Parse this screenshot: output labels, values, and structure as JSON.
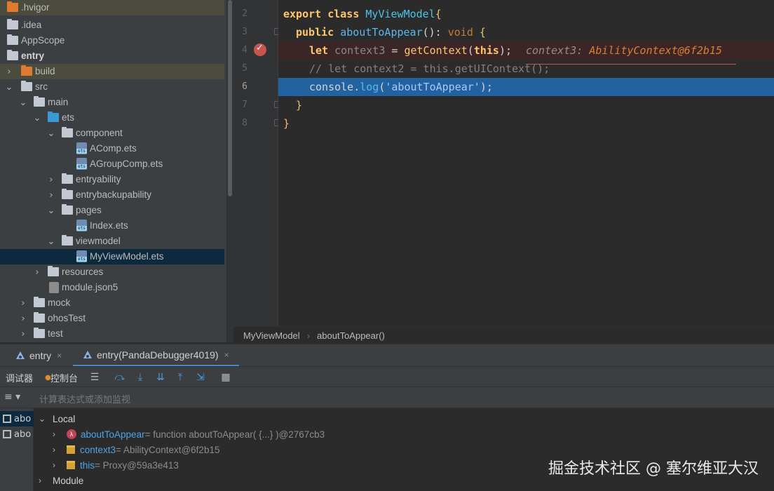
{
  "project_tree": {
    "items": [
      {
        "label": ".hvigor",
        "icon": "folder-orange-icon"
      },
      {
        "label": ".idea",
        "icon": "folder-icon"
      },
      {
        "label": "AppScope",
        "icon": "folder-icon"
      },
      {
        "label": "entry",
        "icon": "module-folder-icon"
      },
      {
        "label": "build",
        "icon": "folder-orange-icon"
      },
      {
        "label": "src",
        "icon": "folder-icon"
      },
      {
        "label": "main",
        "icon": "folder-icon"
      },
      {
        "label": "ets",
        "icon": "folder-blue-icon"
      },
      {
        "label": "component",
        "icon": "folder-icon"
      },
      {
        "label": "AComp.ets",
        "icon": "ets-file-icon"
      },
      {
        "label": "AGroupComp.ets",
        "icon": "ets-file-icon"
      },
      {
        "label": "entryability",
        "icon": "folder-icon"
      },
      {
        "label": "entrybackupability",
        "icon": "folder-icon"
      },
      {
        "label": "pages",
        "icon": "folder-icon"
      },
      {
        "label": "Index.ets",
        "icon": "ets-file-icon"
      },
      {
        "label": "viewmodel",
        "icon": "folder-icon"
      },
      {
        "label": "MyViewModel.ets",
        "icon": "ets-file-icon"
      },
      {
        "label": "resources",
        "icon": "folder-icon"
      },
      {
        "label": "module.json5",
        "icon": "json-file-icon"
      },
      {
        "label": "mock",
        "icon": "folder-icon"
      },
      {
        "label": "ohosTest",
        "icon": "folder-icon"
      },
      {
        "label": "test",
        "icon": "folder-icon"
      }
    ]
  },
  "editor": {
    "line_numbers": [
      "2",
      "3",
      "4",
      "5",
      "6",
      "7",
      "8"
    ],
    "lines": {
      "l2_kw": "export class ",
      "l2_cls": "MyViewModel",
      "l2_brace": "{",
      "l3_kw": "public ",
      "l3_fn": "aboutToAppear",
      "l3_rest": "(): ",
      "l3_void": "void",
      "l3_brace": " {",
      "l4_kw": "let ",
      "l4_var": "context3",
      "l4_eq": " = ",
      "l4_fn": "getContext",
      "l4_p1": "(",
      "l4_this": "this",
      "l4_p2": ");",
      "l4_inline_label": "context3: ",
      "l4_inline_value": "AbilityContext@6f2b15",
      "l5_comment": "// let context2 = this.getUIContext();",
      "l6_obj": "console",
      "l6_dot": ".",
      "l6_fn": "log",
      "l6_p1": "(",
      "l6_str": "'aboutToAppear'",
      "l6_p2": ");",
      "l7": "}",
      "l8": "}"
    },
    "breadcrumb": [
      "MyViewModel",
      "aboutToAppear()"
    ]
  },
  "debug": {
    "tabs": [
      {
        "label": "entry",
        "icon": "run-config-icon"
      },
      {
        "label": "entry(PandaDebugger4019)",
        "icon": "run-config-icon"
      }
    ],
    "close_glyph": "×",
    "toolbar": {
      "debugger_tab": "调试器",
      "console_tab": "控制台",
      "icons": [
        "frames-icon",
        "step-over-icon",
        "step-into-icon",
        "force-step-into-icon",
        "step-out-icon",
        "run-to-cursor-icon",
        "evaluate-icon"
      ]
    },
    "watch_placeholder": "计算表达式或添加监视",
    "frames": [
      "abo",
      "abo"
    ],
    "variables": {
      "local_label": "Local",
      "items": [
        {
          "name": "aboutToAppear",
          "value": " = function aboutToAppear( {...} )@2767cb3",
          "icon": "function-icon"
        },
        {
          "name": "context3",
          "value": " = AbilityContext@6f2b15",
          "icon": "object-icon"
        },
        {
          "name": "this",
          "value": " = Proxy@59a3e413",
          "icon": "object-icon"
        }
      ],
      "module_label": "Module"
    }
  },
  "watermark": "掘金技术社区 @ 塞尔维亚大汉",
  "colors": {
    "accent": "#4a88c7",
    "breakpoint": "#c75450",
    "current_line": "#2262a0"
  }
}
